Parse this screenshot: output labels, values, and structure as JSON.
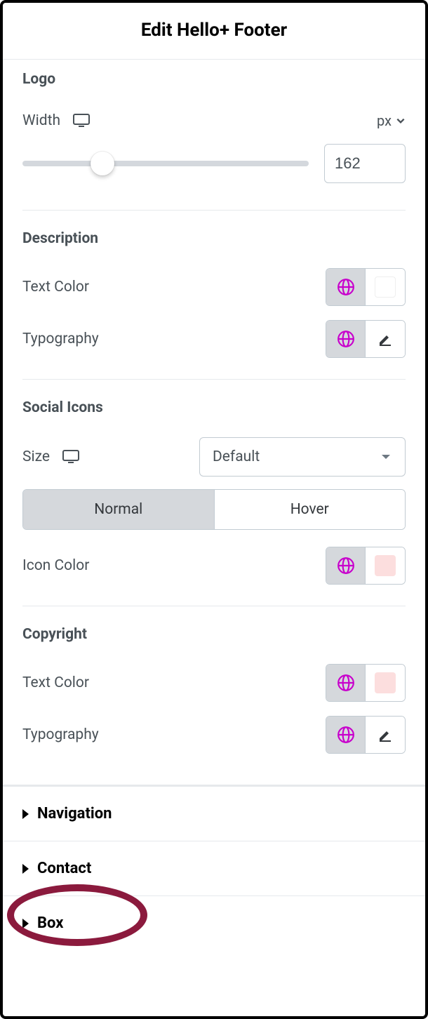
{
  "header": {
    "title": "Edit Hello+ Footer"
  },
  "logo": {
    "section_label": "Logo",
    "width_label": "Width",
    "unit": "px",
    "value": "162"
  },
  "description": {
    "section_label": "Description",
    "text_color_label": "Text Color",
    "typography_label": "Typography"
  },
  "social": {
    "section_label": "Social Icons",
    "size_label": "Size",
    "size_value": "Default",
    "tab_normal": "Normal",
    "tab_hover": "Hover",
    "icon_color_label": "Icon Color",
    "icon_color_swatch": "#fcdede"
  },
  "copyright": {
    "section_label": "Copyright",
    "text_color_label": "Text Color",
    "text_color_swatch": "#fcdede",
    "typography_label": "Typography"
  },
  "sections": {
    "navigation": "Navigation",
    "contact": "Contact",
    "box": "Box"
  },
  "colors": {
    "globe": "#c800cc"
  }
}
